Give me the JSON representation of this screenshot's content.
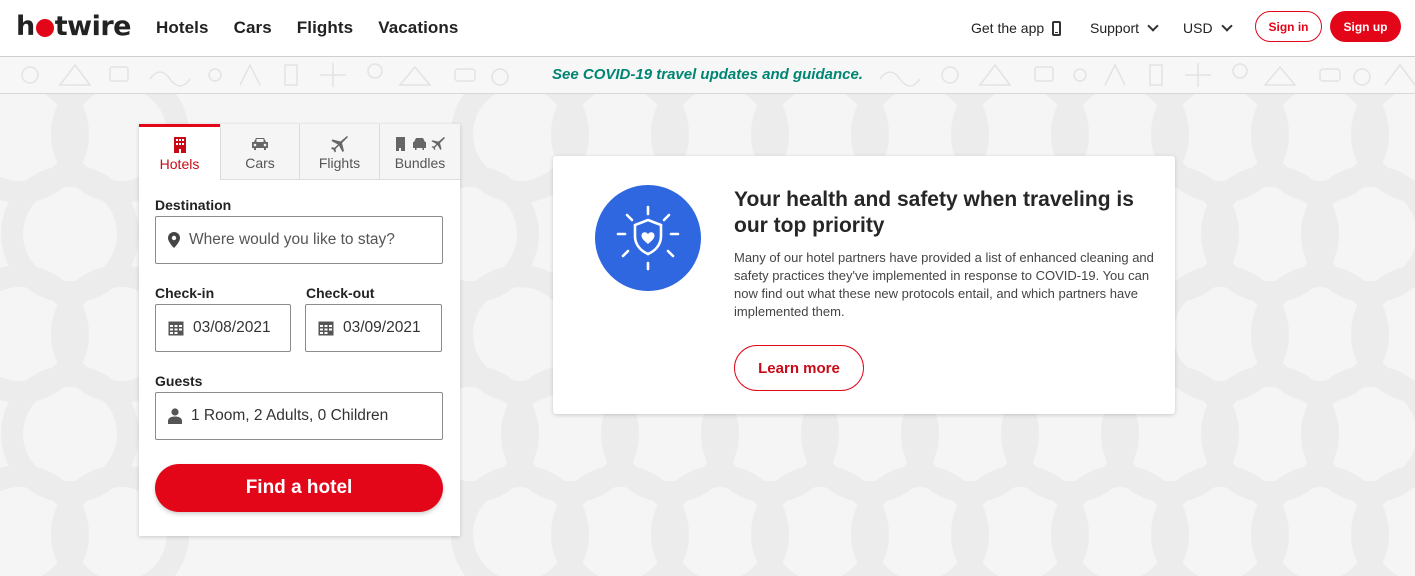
{
  "brand": {
    "name_pre": "h",
    "name_post": "twire",
    "accent": "#e30619"
  },
  "nav": {
    "links": [
      "Hotels",
      "Cars",
      "Flights",
      "Vacations"
    ],
    "get_app": "Get the app",
    "support": "Support",
    "currency": "USD",
    "sign_in": "Sign in",
    "sign_up": "Sign up"
  },
  "banner": {
    "text": "See COVID-19 travel updates and guidance.",
    "color": "#008573"
  },
  "search": {
    "tabs": [
      {
        "label": "Hotels",
        "icon": "hotel-icon",
        "active": true
      },
      {
        "label": "Cars",
        "icon": "car-icon",
        "active": false
      },
      {
        "label": "Flights",
        "icon": "plane-icon",
        "active": false
      },
      {
        "label": "Bundles",
        "icon": "bundle-icon",
        "active": false
      }
    ],
    "destination_label": "Destination",
    "destination_placeholder": "Where would you like to stay?",
    "checkin_label": "Check-in",
    "checkin_value": "03/08/2021",
    "checkout_label": "Check-out",
    "checkout_value": "03/09/2021",
    "guests_label": "Guests",
    "guests_value": "1 Room, 2 Adults, 0 Children",
    "submit": "Find a hotel"
  },
  "info": {
    "title": "Your health and safety when traveling is our top priority",
    "body": "Many of our hotel partners have provided a list of enhanced cleaning and safety practices they've implemented in response to COVID-19. You can now find out what these new protocols entail, and which partners have implemented them.",
    "cta": "Learn more",
    "icon": "shield-heart-icon",
    "icon_color": "#2f67e0"
  }
}
